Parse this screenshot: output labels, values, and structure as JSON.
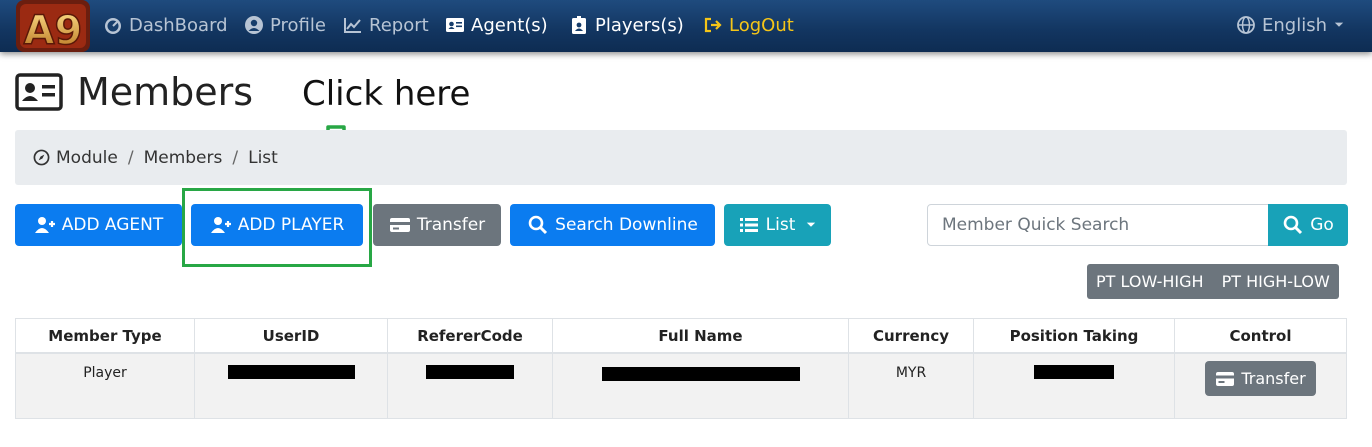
{
  "nav": {
    "logo_text": "A9",
    "items": [
      {
        "label": "DashBoard",
        "icon": "dashboard-icon"
      },
      {
        "label": "Profile",
        "icon": "user-circle-icon"
      },
      {
        "label": "Report",
        "icon": "chart-line-icon"
      },
      {
        "label": "Agent(s)",
        "icon": "id-card-icon"
      },
      {
        "label": "Players(s)",
        "icon": "id-badge-icon"
      },
      {
        "label": "LogOut",
        "icon": "sign-out-icon"
      }
    ],
    "language": "English"
  },
  "page": {
    "title": "Members",
    "annotation": "Click here",
    "accent_green": "#28a745"
  },
  "breadcrumb": [
    "Module",
    "Members",
    "List"
  ],
  "toolbar": {
    "add_agent": "ADD AGENT",
    "add_player": "ADD PLAYER",
    "transfer": "Transfer",
    "search_downline": "Search Downline",
    "list": "List",
    "search_placeholder": "Member Quick Search",
    "go": "Go",
    "pt_low_high": "PT LOW-HIGH",
    "pt_high_low": "PT HIGH-LOW"
  },
  "table": {
    "headers": [
      "Member Type",
      "UserID",
      "RefererCode",
      "Full Name",
      "Currency",
      "Position Taking",
      "Control"
    ],
    "rows": [
      {
        "member_type": "Player",
        "currency": "MYR",
        "control": "Transfer"
      }
    ]
  }
}
